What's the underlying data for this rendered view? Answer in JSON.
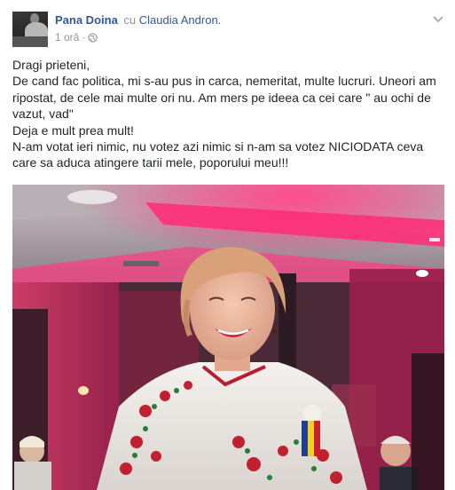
{
  "post": {
    "author": "Pana Doina",
    "with_word": "cu",
    "tagged": "Claudia Andron.",
    "time": "1 oră",
    "separator": "·",
    "privacy_icon": "globe-icon",
    "menu_icon": "chevron-down-icon",
    "text_lines": [
      "Dragi prieteni,",
      "De cand fac politica, mi s-au pus in carca, nemeritat, multe lucruri. Uneori am ripostat, de cele mai multe ori nu. Am mers pe ideea ca cei care \" au ochi de vazut, vad\"",
      "Deja e mult prea mult!",
      "N-am votat ieri nimic, nu votez azi nimic si n-am sa votez NICIODATA ceva care sa aduca atingere tarii mele, poporului meu!!!"
    ]
  },
  "colors": {
    "link": "#365899",
    "meta": "#90949c",
    "text": "#1d2129",
    "photo_ceiling_light": "#ff2d7a",
    "photo_background": "#3a1f2a"
  }
}
